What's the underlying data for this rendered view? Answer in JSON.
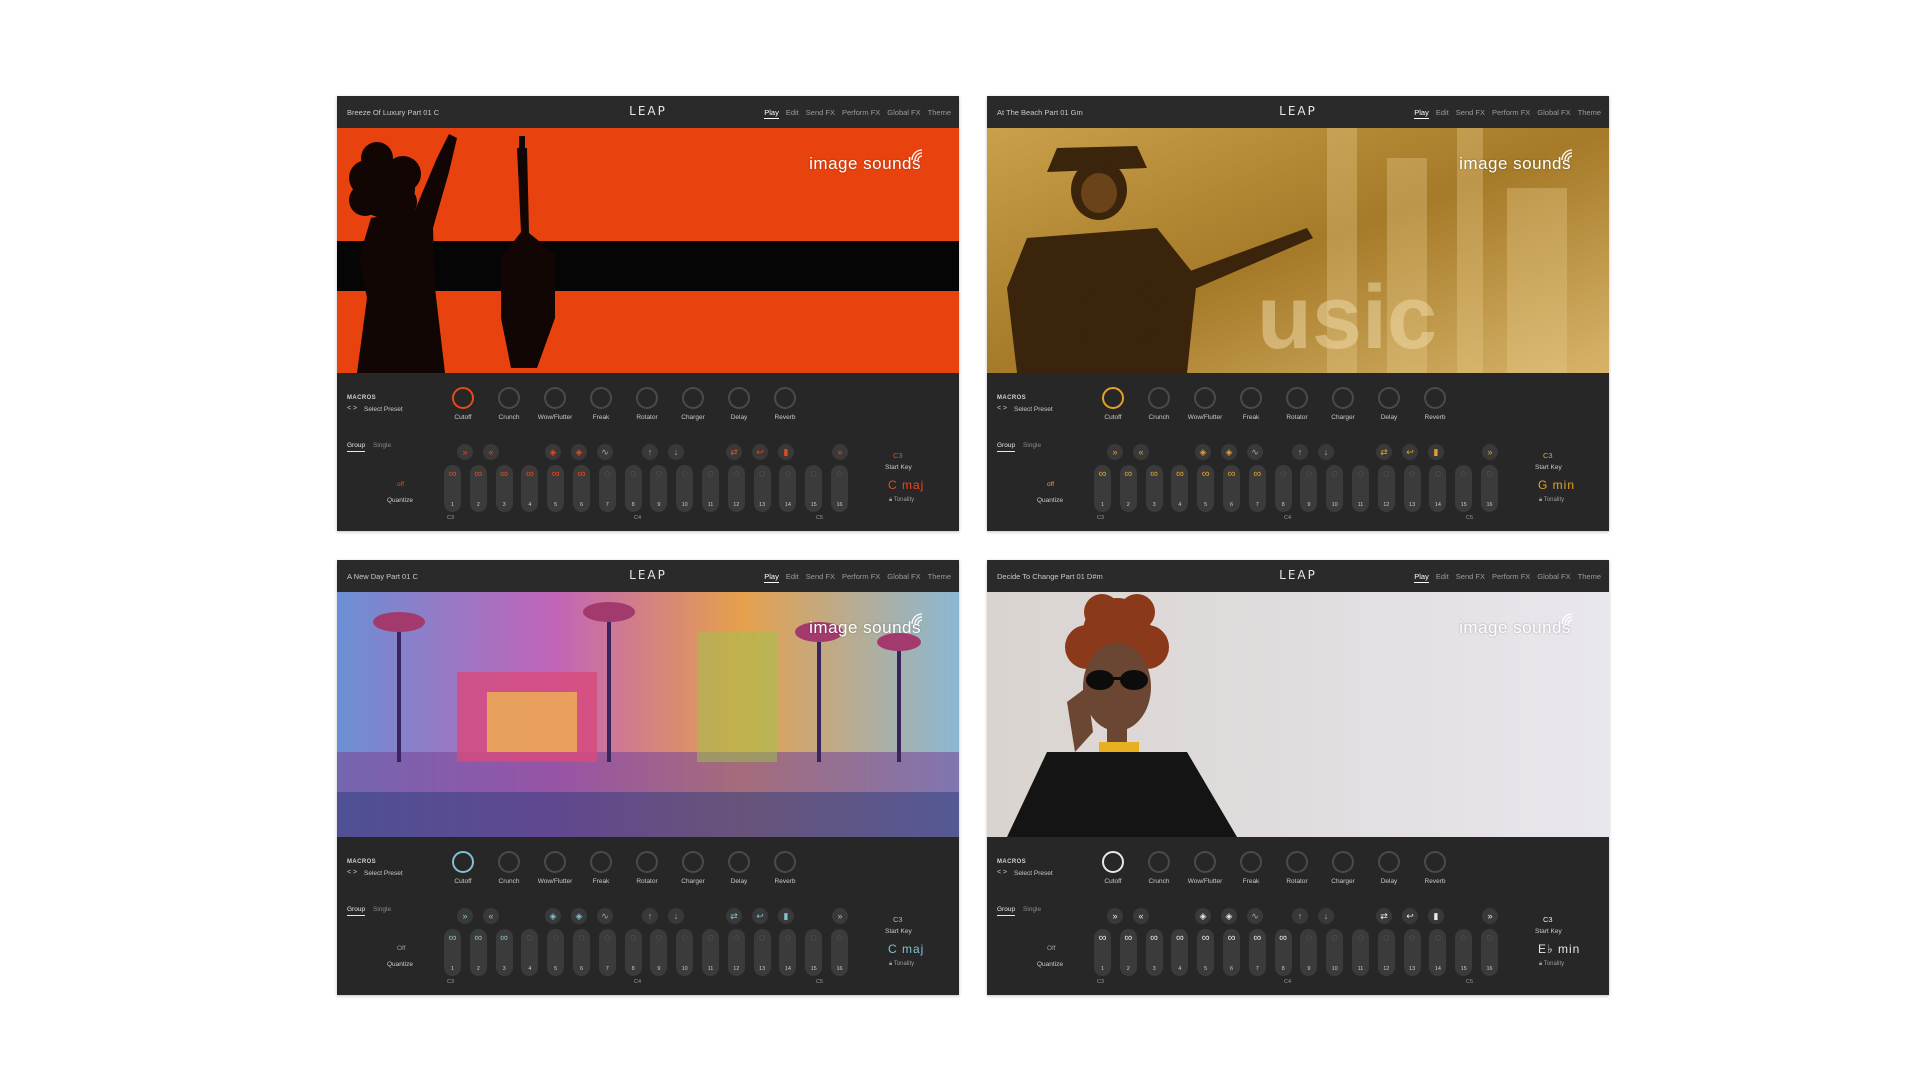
{
  "logo": "LEAP",
  "brand": "image sounds",
  "nav": [
    "Play",
    "Edit",
    "Send FX",
    "Perform FX",
    "Global FX",
    "Theme"
  ],
  "macros_title": "MACROS",
  "select_preset": "Select Preset",
  "knobs": [
    "Cutoff",
    "Crunch",
    "Wow/Flutter",
    "Freak",
    "Rotator",
    "Charger",
    "Delay",
    "Reverb"
  ],
  "modes": {
    "group": "Group",
    "single": "Single"
  },
  "quantize_label": "Quantize",
  "start_key_label": "Start Key",
  "tonality_label": "Tonality",
  "octaves": [
    "C3",
    "C4",
    "C5"
  ],
  "slot_numbers": [
    "1",
    "2",
    "3",
    "4",
    "5",
    "6",
    "7",
    "8",
    "9",
    "10",
    "11",
    "12",
    "13",
    "14",
    "15",
    "16"
  ],
  "icons": {
    "nav_arrows": "chevron-left-right-icon",
    "lock": "lock-icon",
    "loop": "infinity-icon",
    "empty": "dashed-circle-icon"
  },
  "transport_icons": [
    "fast-forward-icon",
    "rewind-icon",
    "diamond-icon",
    "diamond-icon",
    "wave-icon",
    "arrow-up-icon",
    "arrow-down-icon",
    "swap-icon",
    "return-icon",
    "bars-icon",
    "fast-forward-icon"
  ],
  "panels": [
    {
      "preset": "Breeze Of Luxury Part 01 C",
      "accent": "#e8491c",
      "quantize": "off",
      "start_key": "C3",
      "tonality": "C  maj",
      "active_slots": [
        1,
        2,
        3,
        4,
        5,
        6
      ],
      "art": "orange-guitar"
    },
    {
      "preset": "At The Beach Part 01 Gm",
      "accent": "#e3a22c",
      "quantize": "off",
      "start_key": "C3",
      "tonality": "G  min",
      "active_slots": [
        1,
        2,
        3,
        4,
        5,
        6,
        7
      ],
      "art": "gold-musician"
    },
    {
      "preset": "A New Day Part 01 C",
      "accent": "#7fc1cf",
      "quantize": "Off",
      "start_key": "C3",
      "tonality": "C  maj",
      "active_slots": [
        1,
        2,
        3
      ],
      "art": "psychedelic-palms"
    },
    {
      "preset": "Decide To Change Part 01 D#m",
      "accent": "#e8e8e8",
      "quantize": "Off",
      "start_key": "C3",
      "tonality": "E♭ min",
      "active_slots": [
        1,
        2,
        3,
        4,
        5,
        6,
        7,
        8
      ],
      "art": "woman-sunglasses"
    }
  ]
}
